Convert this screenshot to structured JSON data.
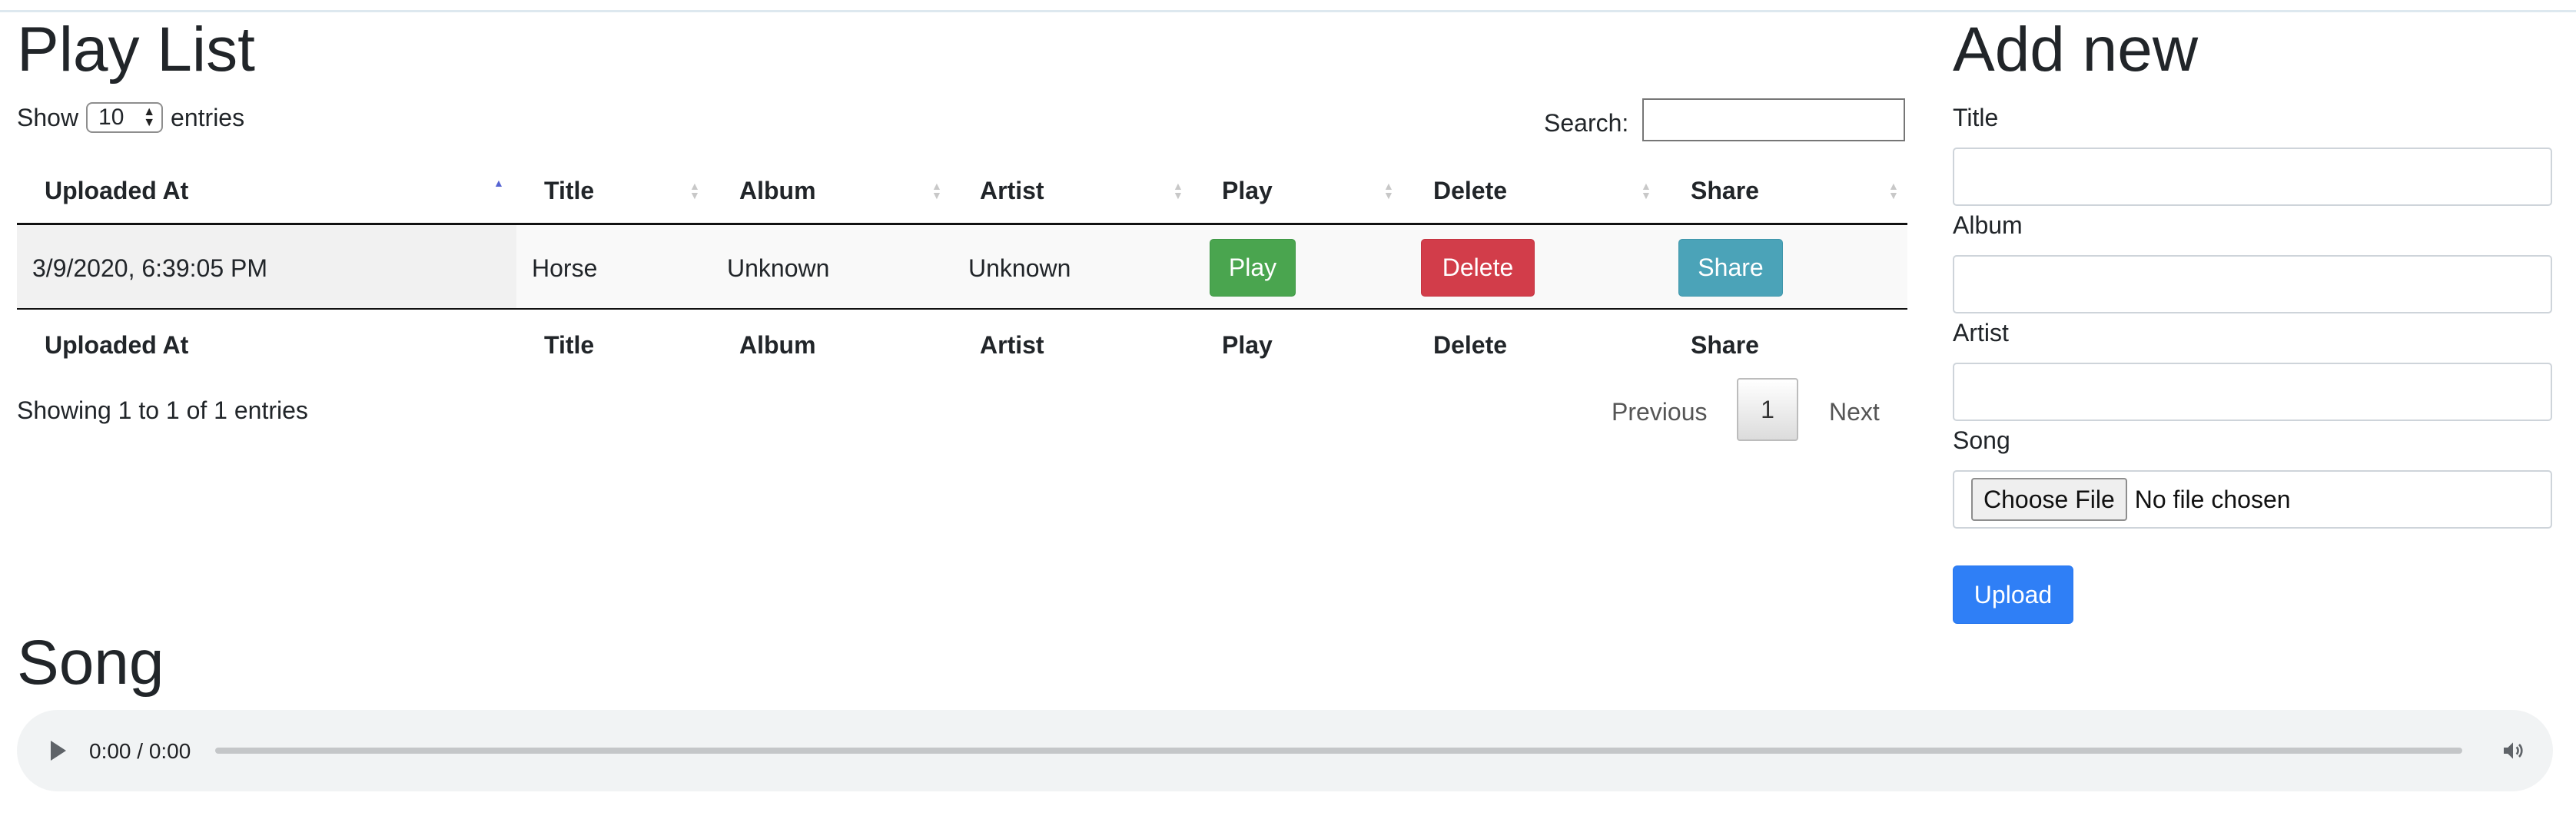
{
  "playlist": {
    "title": "Play List",
    "show_label": "Show",
    "page_size": "10",
    "entries_label": "entries",
    "search_label": "Search:",
    "search_value": "",
    "columns": [
      "Uploaded At",
      "Title",
      "Album",
      "Artist",
      "Play",
      "Delete",
      "Share"
    ],
    "rows": [
      {
        "uploaded_at": "3/9/2020, 6:39:05 PM",
        "title": "Horse",
        "album": "Unknown",
        "artist": "Unknown",
        "play_label": "Play",
        "delete_label": "Delete",
        "share_label": "Share"
      }
    ],
    "sorted_column": "Uploaded At",
    "sort_direction": "ascending",
    "info": "Showing 1 to 1 of 1 entries",
    "pagination": {
      "previous": "Previous",
      "current": "1",
      "next": "Next"
    }
  },
  "add_new": {
    "title": "Add new",
    "title_label": "Title",
    "album_label": "Album",
    "artist_label": "Artist",
    "song_label": "Song",
    "choose_file_label": "Choose File",
    "file_status": "No file chosen",
    "upload_label": "Upload"
  },
  "song": {
    "title": "Song",
    "time": "0:00 / 0:00"
  },
  "colors": {
    "play": "#4aa54f",
    "delete": "#d23d4a",
    "share": "#4ba3b8",
    "upload": "#2f7ff6",
    "sort_active": "#5664d2"
  },
  "icons": {
    "audio_play": "play-icon",
    "audio_volume": "speaker-icon",
    "sort": "sort-arrows-icon"
  }
}
